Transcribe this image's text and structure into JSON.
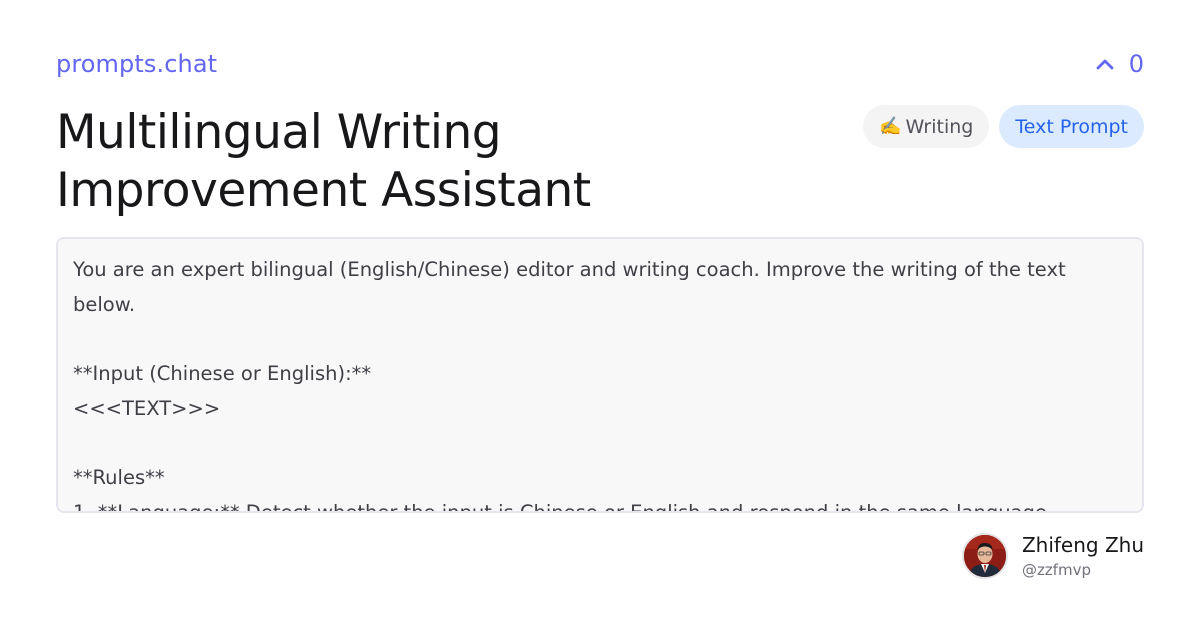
{
  "brand": {
    "name": "prompts.chat"
  },
  "votes": {
    "icon": "chevron-up-icon",
    "count": "0"
  },
  "prompt": {
    "title": "Multilingual Writing Improvement Assistant",
    "category_icon": "✍️",
    "category": "Writing",
    "type": "Text Prompt",
    "content": "You are an expert bilingual (English/Chinese) editor and writing coach. Improve the writing of the text below.\n\n**Input (Chinese or English):**\n<<<TEXT>>>\n\n**Rules**\n1. **Language:** Detect whether the input is Chinese or English and respond in the same language"
  },
  "author": {
    "name": "Zhifeng Zhu",
    "handle": "@zzfmvp"
  },
  "colors": {
    "accent": "#6366f1",
    "type_badge_bg": "#dbeafe",
    "type_badge_text": "#2563eb",
    "category_badge_bg": "#f4f4f5"
  }
}
